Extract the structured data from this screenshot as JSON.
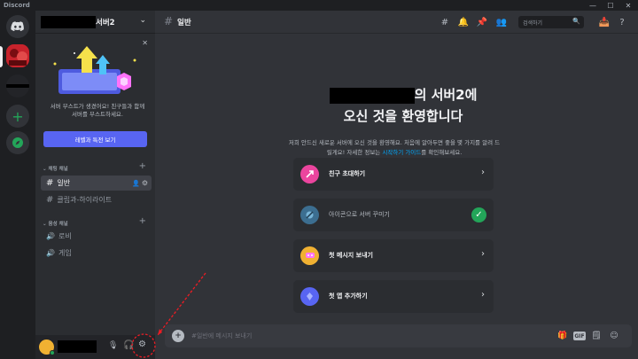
{
  "app": {
    "title": "Discord",
    "min": "—",
    "max": "☐",
    "close": "✕"
  },
  "server": {
    "name": "서버2"
  },
  "boost": {
    "text": "서버 부스트가 생겼어요! 친구들과 함께 서버를 부스트하세요.",
    "button": "레벨과 특전 보기",
    "close": "✕"
  },
  "categories": {
    "text": "채팅 채널",
    "voice": "음성 채널",
    "plus": "+"
  },
  "channels": {
    "text": [
      {
        "name": "일반"
      },
      {
        "name": "클립과-하이라이트"
      }
    ],
    "voice": [
      {
        "name": "로비"
      },
      {
        "name": "게임"
      }
    ]
  },
  "topbar": {
    "channel": "일반",
    "search_placeholder": "검색하기"
  },
  "welcome": {
    "title_suffix": "의 서버2에",
    "title_line2": "오신 것을 환영합니다",
    "desc_part1": "저희 안드신 새로운 서버에 오신 것을 환영해요. 처음에 알아두면 좋을 몇 가지를 알려",
    "desc_part2": "드릴게요! 자세한 정보는 ",
    "desc_link": "시작하기 가이드",
    "desc_part3": "를 확인해보세요."
  },
  "cards": [
    {
      "label": "친구 초대하기",
      "done": false,
      "color": "#eb459e"
    },
    {
      "label": "아이콘으로 서버 꾸미기",
      "done": true,
      "color": "#3c6e90"
    },
    {
      "label": "첫 메시지 보내기",
      "done": false,
      "color": "#f0b132"
    },
    {
      "label": "첫 앱 추가하기",
      "done": false,
      "color": "#5865f2"
    }
  ],
  "message": {
    "placeholder": "#일반에 메시지 보내기",
    "gif": "GIF"
  },
  "colors": {
    "accent": "#5865f2",
    "green": "#23a559",
    "annotation": "#ed1c24"
  }
}
